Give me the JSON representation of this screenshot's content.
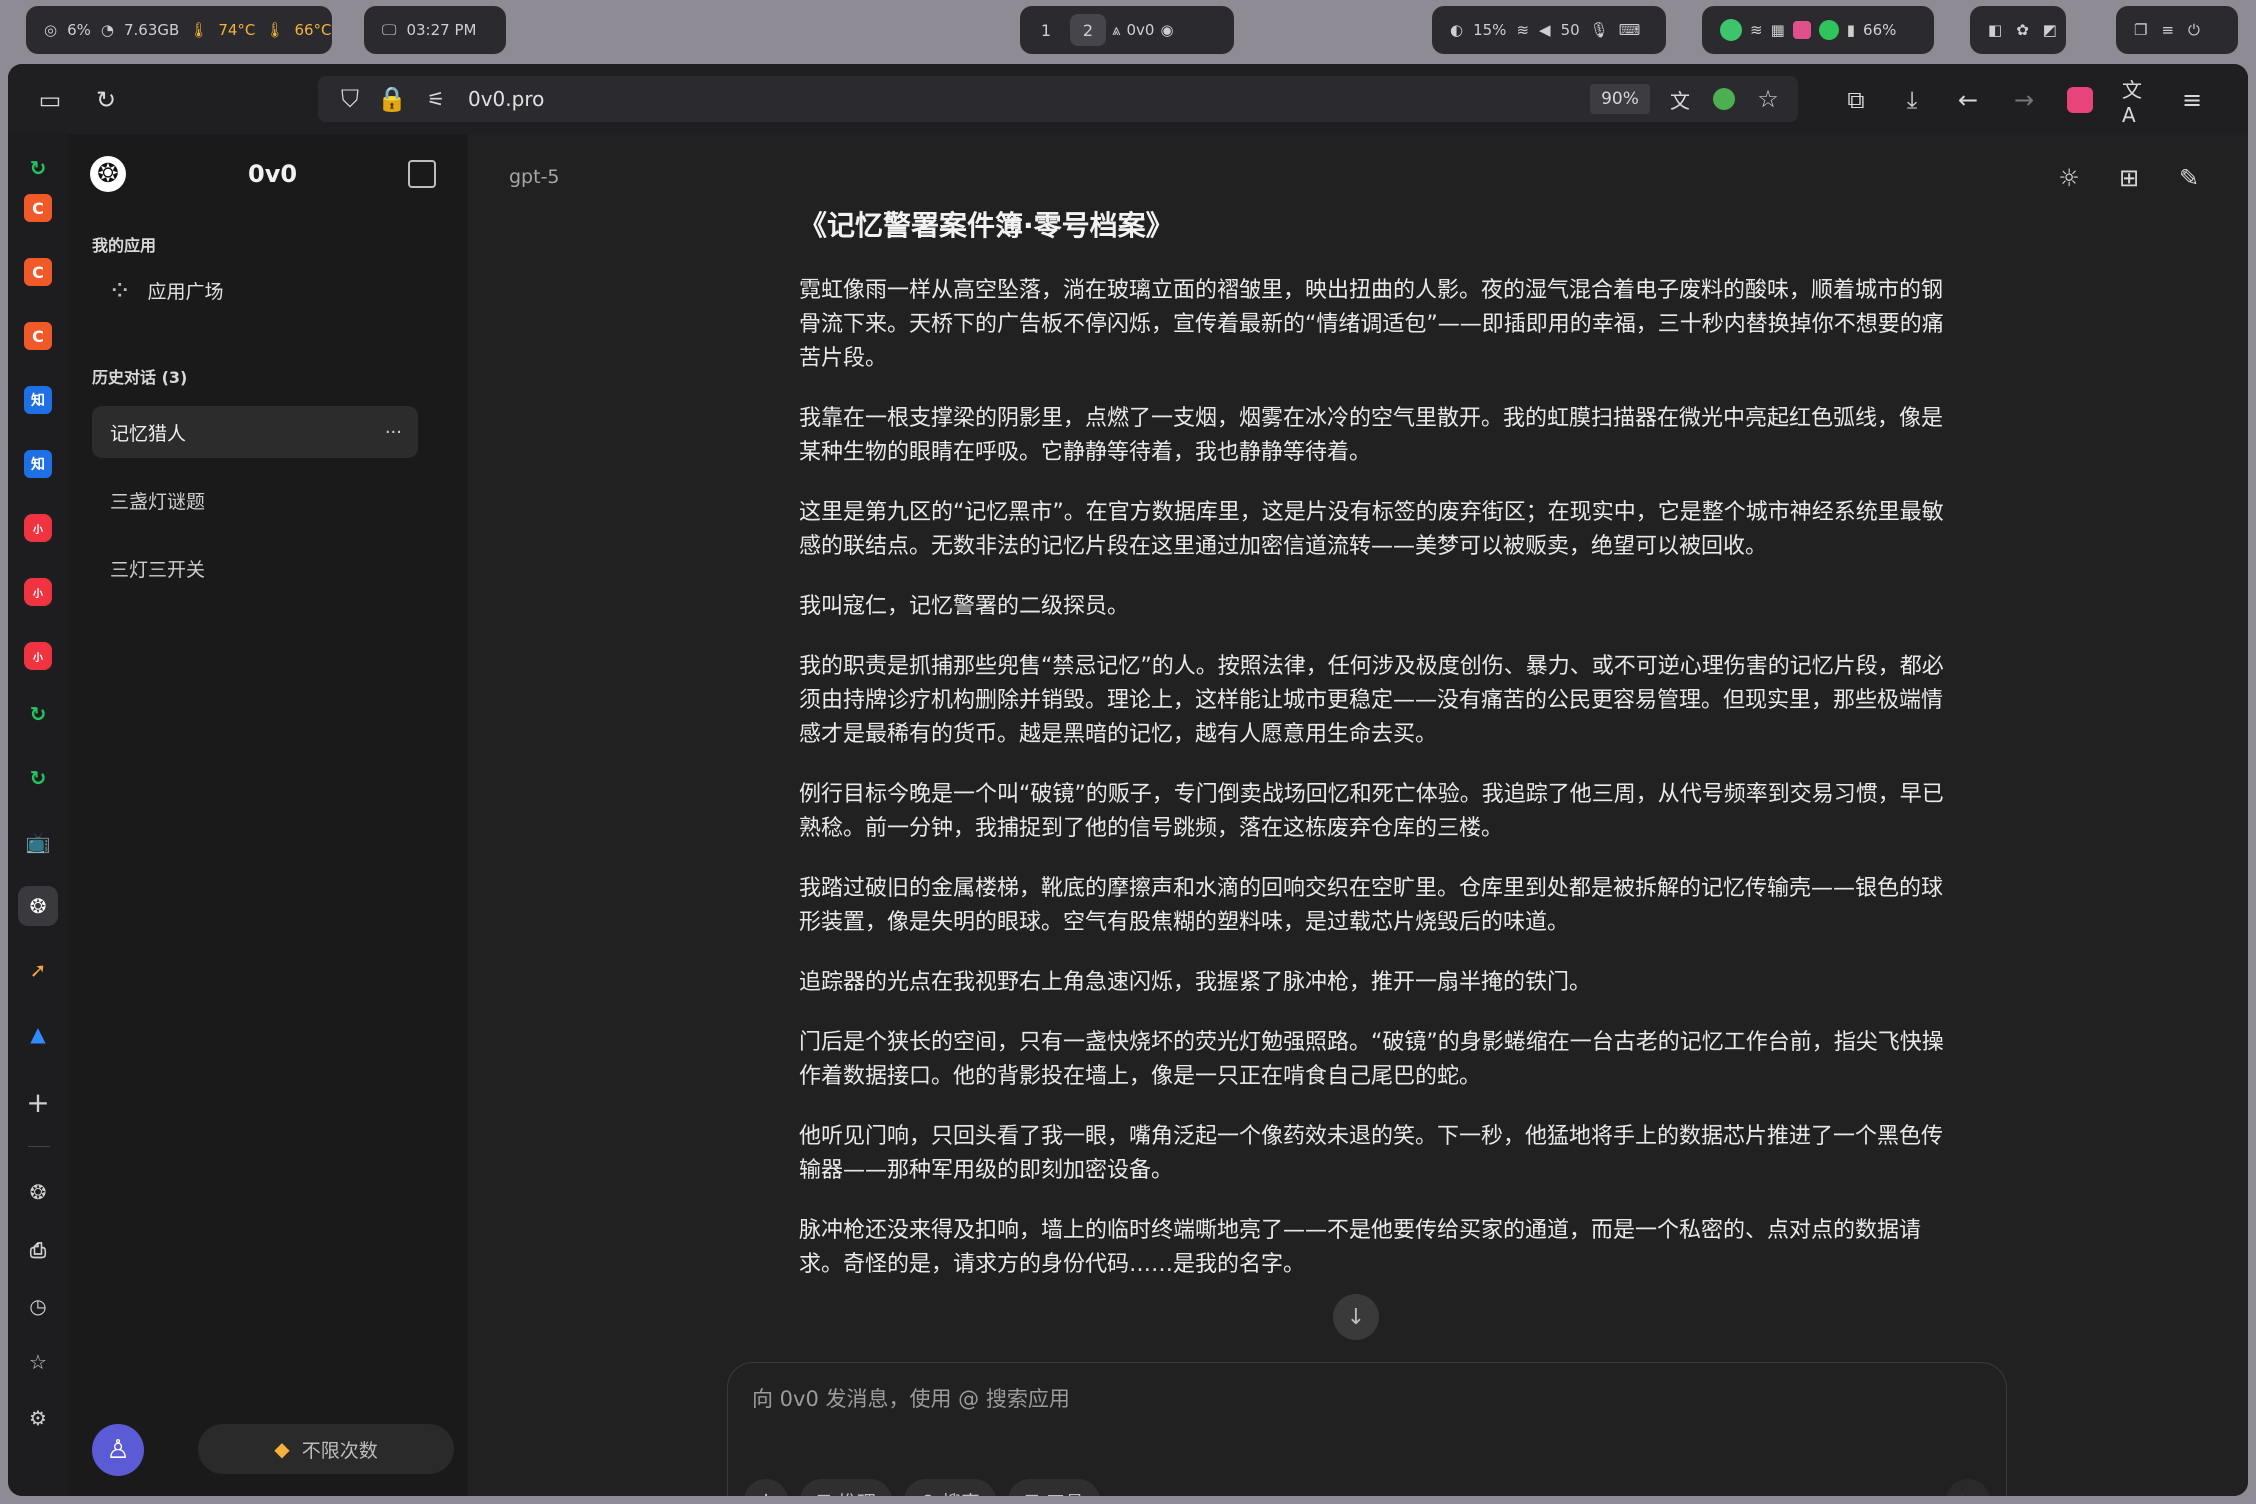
{
  "sysbar": {
    "stats": {
      "cpu": "6%",
      "mem": "7.63GB",
      "temp1": "74°C",
      "temp2": "66°C"
    },
    "clock": "03:27 PM",
    "workspaces": [
      "1",
      "2"
    ],
    "active_workspace": "2",
    "window_label": "0v0",
    "status": {
      "brightness": "15%",
      "volume": "50",
      "battery": "66%"
    }
  },
  "browser": {
    "url": "0v0.pro",
    "zoom": "90%"
  },
  "sidebar": {
    "app_name": "0v0",
    "section_my_apps": "我的应用",
    "app_square": "应用广场",
    "history_title": "历史对话 (3)",
    "chats": [
      "记忆猎人",
      "三盏灯谜题",
      "三灯三开关"
    ],
    "more_label": "···",
    "unlimited": "不限次数"
  },
  "main": {
    "model": "gpt-5",
    "story_title": "《记忆警署案件簿·零号档案》",
    "paragraphs": [
      "霓虹像雨一样从高空坠落，淌在玻璃立面的褶皱里，映出扭曲的人影。夜的湿气混合着电子废料的酸味，顺着城市的钢骨流下来。天桥下的广告板不停闪烁，宣传着最新的“情绪调适包”——即插即用的幸福，三十秒内替换掉你不想要的痛苦片段。",
      "我靠在一根支撑梁的阴影里，点燃了一支烟，烟雾在冰冷的空气里散开。我的虹膜扫描器在微光中亮起红色弧线，像是某种生物的眼睛在呼吸。它静静等待着，我也静静等待着。",
      "这里是第九区的“记忆黑市”。在官方数据库里，这是片没有标签的废弃街区；在现实中，它是整个城市神经系统里最敏感的联结点。无数非法的记忆片段在这里通过加密信道流转——美梦可以被贩卖，绝望可以被回收。",
      "我叫寇仁，记忆警署的二级探员。",
      "我的职责是抓捕那些兜售“禁忌记忆”的人。按照法律，任何涉及极度创伤、暴力、或不可逆心理伤害的记忆片段，都必须由持牌诊疗机构删除并销毁。理论上，这样能让城市更稳定——没有痛苦的公民更容易管理。但现实里，那些极端情感才是最稀有的货币。越是黑暗的记忆，越有人愿意用生命去买。",
      "例行目标今晚是一个叫“破镜”的贩子，专门倒卖战场回忆和死亡体验。我追踪了他三周，从代号频率到交易习惯，早已熟稔。前一分钟，我捕捉到了他的信号跳频，落在这栋废弃仓库的三楼。",
      "我踏过破旧的金属楼梯，靴底的摩擦声和水滴的回响交织在空旷里。仓库里到处都是被拆解的记忆传输壳——银色的球形装置，像是失明的眼球。空气有股焦糊的塑料味，是过载芯片烧毁后的味道。",
      "追踪器的光点在我视野右上角急速闪烁，我握紧了脉冲枪，推开一扇半掩的铁门。",
      "门后是个狭长的空间，只有一盏快烧坏的荧光灯勉强照路。“破镜”的身影蜷缩在一台古老的记忆工作台前，指尖飞快操作着数据接口。他的背影投在墙上，像是一只正在啃食自己尾巴的蛇。",
      "他听见门响，只回头看了我一眼，嘴角泛起一个像药效未退的笑。下一秒，他猛地将手上的数据芯片推进了一个黑色传输器——那种军用级的即刻加密设备。",
      "脉冲枪还没来得及扣响，墙上的临时终端嘶地亮了——不是他要传给买家的通道，而是一个私密的、点对点的数据请求。奇怪的是，请求方的身份代码……是我的名字。"
    ],
    "composer_placeholder": "向 0v0 发消息，使用 @ 搜索应用",
    "tools": {
      "reason": "推理",
      "search": "搜索",
      "tool": "工具"
    }
  },
  "colors": {
    "accent": "#5b5bd6",
    "green": "#22c55e",
    "red": "#f05a28"
  }
}
